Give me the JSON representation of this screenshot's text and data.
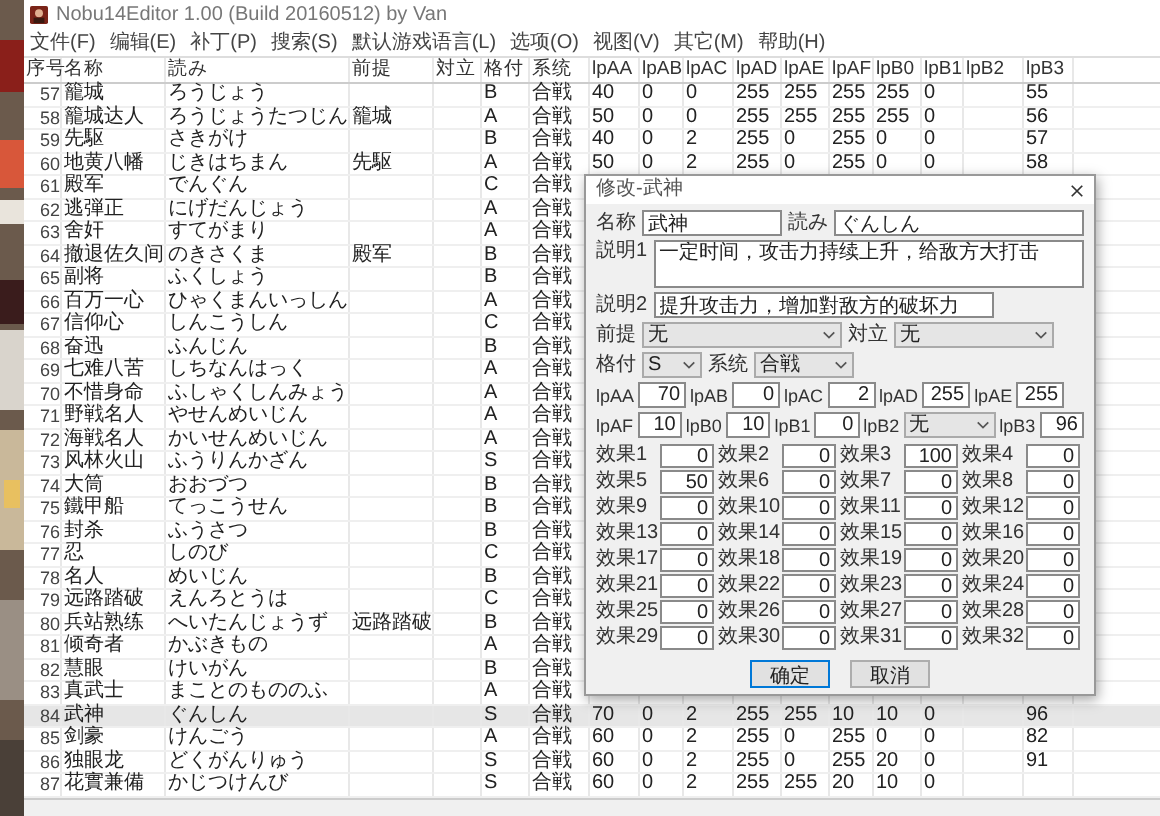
{
  "window": {
    "title": "Nobu14Editor 1.00 (Build 20160512) by Van"
  },
  "menu": [
    "文件(F)",
    "编辑(E)",
    "补丁(P)",
    "搜索(S)",
    "默认游戏语言(L)",
    "选项(O)",
    "视图(V)",
    "其它(M)",
    "帮助(H)"
  ],
  "table": {
    "columns": [
      "序号",
      "名称",
      "読み",
      "前提",
      "対立",
      "格付",
      "系统",
      "lpAA",
      "lpAB",
      "lpAC",
      "lpAD",
      "lpAE",
      "lpAF",
      "lpB0",
      "lpB1",
      "lpB2",
      "lpB3"
    ],
    "rows": [
      {
        "cells": [
          "57",
          "籠城",
          "ろうじょう",
          null,
          null,
          "B",
          "合戦",
          "40",
          "0",
          "0",
          "255",
          "255",
          "255",
          "255",
          "0",
          null,
          "55"
        ],
        "selected": false
      },
      {
        "cells": [
          "58",
          "籠城达人",
          "ろうじょうたつじん",
          "籠城",
          null,
          "A",
          "合戦",
          "50",
          "0",
          "0",
          "255",
          "255",
          "255",
          "255",
          "0",
          null,
          "56"
        ],
        "selected": false
      },
      {
        "cells": [
          "59",
          "先駆",
          "さきがけ",
          null,
          null,
          "B",
          "合戦",
          "40",
          "0",
          "2",
          "255",
          "0",
          "255",
          "0",
          "0",
          null,
          "57"
        ],
        "selected": false
      },
      {
        "cells": [
          "60",
          "地黄八幡",
          "じきはちまん",
          "先駆",
          null,
          "A",
          "合戦",
          "50",
          "0",
          "2",
          "255",
          "0",
          "255",
          "0",
          "0",
          null,
          "58"
        ],
        "selected": false
      },
      {
        "cells": [
          "61",
          "殿军",
          "でんぐん",
          null,
          null,
          "C",
          "合戦"
        ],
        "selected": false
      },
      {
        "cells": [
          "62",
          "逃弾正",
          "にげだんじょう",
          null,
          null,
          "A",
          "合戦"
        ],
        "selected": false
      },
      {
        "cells": [
          "63",
          "舍奸",
          "すてがまり",
          null,
          null,
          "A",
          "合戦"
        ],
        "selected": false
      },
      {
        "cells": [
          "64",
          "撤退佐久间",
          "のきさくま",
          "殿军",
          null,
          "B",
          "合戦"
        ],
        "selected": false
      },
      {
        "cells": [
          "65",
          "副将",
          "ふくしょう",
          null,
          null,
          "B",
          "合戦"
        ],
        "selected": false
      },
      {
        "cells": [
          "66",
          "百万一心",
          "ひゃくまんいっしん",
          null,
          null,
          "A",
          "合戦"
        ],
        "selected": false
      },
      {
        "cells": [
          "67",
          "信仰心",
          "しんこうしん",
          null,
          null,
          "C",
          "合戦"
        ],
        "selected": false
      },
      {
        "cells": [
          "68",
          "奋迅",
          "ふんじん",
          null,
          null,
          "B",
          "合戦"
        ],
        "selected": false
      },
      {
        "cells": [
          "69",
          "七难八苦",
          "しちなんはっく",
          null,
          null,
          "A",
          "合戦"
        ],
        "selected": false
      },
      {
        "cells": [
          "70",
          "不惜身命",
          "ふしゃくしんみょう",
          null,
          null,
          "A",
          "合戦"
        ],
        "selected": false
      },
      {
        "cells": [
          "71",
          "野戦名人",
          "やせんめいじん",
          null,
          null,
          "A",
          "合戦"
        ],
        "selected": false
      },
      {
        "cells": [
          "72",
          "海戦名人",
          "かいせんめいじん",
          null,
          null,
          "A",
          "合戦"
        ],
        "selected": false
      },
      {
        "cells": [
          "73",
          "风林火山",
          "ふうりんかざん",
          null,
          null,
          "S",
          "合戦"
        ],
        "selected": false
      },
      {
        "cells": [
          "74",
          "大筒",
          "おおづつ",
          null,
          null,
          "B",
          "合戦"
        ],
        "selected": false
      },
      {
        "cells": [
          "75",
          "鐵甲船",
          "てっこうせん",
          null,
          null,
          "B",
          "合戦"
        ],
        "selected": false
      },
      {
        "cells": [
          "76",
          "封杀",
          "ふうさつ",
          null,
          null,
          "B",
          "合戦"
        ],
        "selected": false
      },
      {
        "cells": [
          "77",
          "忍",
          "しのび",
          null,
          null,
          "C",
          "合戦"
        ],
        "selected": false
      },
      {
        "cells": [
          "78",
          "名人",
          "めいじん",
          null,
          null,
          "B",
          "合戦"
        ],
        "selected": false
      },
      {
        "cells": [
          "79",
          "远路踏破",
          "えんろとうは",
          null,
          null,
          "C",
          "合戦"
        ],
        "selected": false
      },
      {
        "cells": [
          "80",
          "兵站熟练",
          "へいたんじょうず",
          "远路踏破",
          null,
          "B",
          "合戦"
        ],
        "selected": false
      },
      {
        "cells": [
          "81",
          "倾奇者",
          "かぶきもの",
          null,
          null,
          "A",
          "合戦"
        ],
        "selected": false
      },
      {
        "cells": [
          "82",
          "慧眼",
          "けいがん",
          null,
          null,
          "B",
          "合戦"
        ],
        "selected": false
      },
      {
        "cells": [
          "83",
          "真武士",
          "まことのもののふ",
          null,
          null,
          "A",
          "合戦"
        ],
        "selected": false
      },
      {
        "cells": [
          "84",
          "武神",
          "ぐんしん",
          null,
          null,
          "S",
          "合戦",
          "70",
          "0",
          "2",
          "255",
          "255",
          "10",
          "10",
          "0",
          null,
          "96"
        ],
        "selected": true
      },
      {
        "cells": [
          "85",
          "剑豪",
          "けんごう",
          null,
          null,
          "A",
          "合戦",
          "60",
          "0",
          "2",
          "255",
          "0",
          "255",
          "0",
          "0",
          null,
          "82"
        ],
        "selected": false
      },
      {
        "cells": [
          "86",
          "独眼龙",
          "どくがんりゅう",
          null,
          null,
          "S",
          "合戦",
          "60",
          "0",
          "2",
          "255",
          "0",
          "255",
          "20",
          "0",
          null,
          "91"
        ],
        "selected": false
      },
      {
        "cells": [
          "87",
          "花實兼備",
          "かじつけんび",
          null,
          null,
          "S",
          "合戦",
          "60",
          "0",
          "2",
          "255",
          "255",
          "20",
          "10",
          "0",
          null,
          null
        ],
        "selected": false
      }
    ]
  },
  "dialog": {
    "title": "修改-武神",
    "name": {
      "label": "名称",
      "value": "武神"
    },
    "reading": {
      "label": "読み",
      "value": "ぐんしん"
    },
    "desc1": {
      "label": "説明1",
      "value": "一定时间，攻击力持续上升，给敌方大打击"
    },
    "desc2": {
      "label": "説明2",
      "value": "提升攻击力，增加對敌方的破坏力"
    },
    "premise": {
      "label": "前提",
      "value": "无"
    },
    "opposite": {
      "label": "対立",
      "value": "无"
    },
    "grade": {
      "label": "格付",
      "value": "S"
    },
    "system": {
      "label": "系统",
      "value": "合戦"
    },
    "lp_rows": [
      [
        {
          "label": "lpAA",
          "kind": "input",
          "value": "70"
        },
        {
          "label": "lpAB",
          "kind": "input",
          "value": "0"
        },
        {
          "label": "lpAC",
          "kind": "input",
          "value": "2"
        },
        {
          "label": "lpAD",
          "kind": "input",
          "value": "255"
        },
        {
          "label": "lpAE",
          "kind": "input",
          "value": "255"
        }
      ],
      [
        {
          "label": "lpAF",
          "kind": "input",
          "value": "10"
        },
        {
          "label": "lpB0",
          "kind": "input",
          "value": "10"
        },
        {
          "label": "lpB1",
          "kind": "input",
          "value": "0"
        },
        {
          "label": "lpB2",
          "kind": "select",
          "value": "无"
        },
        {
          "label": "lpB3",
          "kind": "input",
          "value": "96"
        }
      ]
    ],
    "effects": [
      {
        "label": "效果1",
        "value": "0"
      },
      {
        "label": "效果2",
        "value": "0"
      },
      {
        "label": "效果3",
        "value": "100"
      },
      {
        "label": "效果4",
        "value": "0"
      },
      {
        "label": "效果5",
        "value": "50"
      },
      {
        "label": "效果6",
        "value": "0"
      },
      {
        "label": "效果7",
        "value": "0"
      },
      {
        "label": "效果8",
        "value": "0"
      },
      {
        "label": "效果9",
        "value": "0"
      },
      {
        "label": "效果10",
        "value": "0"
      },
      {
        "label": "效果11",
        "value": "0"
      },
      {
        "label": "效果12",
        "value": "0"
      },
      {
        "label": "效果13",
        "value": "0"
      },
      {
        "label": "效果14",
        "value": "0"
      },
      {
        "label": "效果15",
        "value": "0"
      },
      {
        "label": "效果16",
        "value": "0"
      },
      {
        "label": "效果17",
        "value": "0"
      },
      {
        "label": "效果18",
        "value": "0"
      },
      {
        "label": "效果19",
        "value": "0"
      },
      {
        "label": "效果20",
        "value": "0"
      },
      {
        "label": "效果21",
        "value": "0"
      },
      {
        "label": "效果22",
        "value": "0"
      },
      {
        "label": "效果23",
        "value": "0"
      },
      {
        "label": "效果24",
        "value": "0"
      },
      {
        "label": "效果25",
        "value": "0"
      },
      {
        "label": "效果26",
        "value": "0"
      },
      {
        "label": "效果27",
        "value": "0"
      },
      {
        "label": "效果28",
        "value": "0"
      },
      {
        "label": "效果29",
        "value": "0"
      },
      {
        "label": "效果30",
        "value": "0"
      },
      {
        "label": "效果31",
        "value": "0"
      },
      {
        "label": "效果32",
        "value": "0"
      }
    ],
    "buttons": [
      {
        "label": "确定",
        "primary": true
      },
      {
        "label": "取消",
        "primary": false
      }
    ]
  }
}
